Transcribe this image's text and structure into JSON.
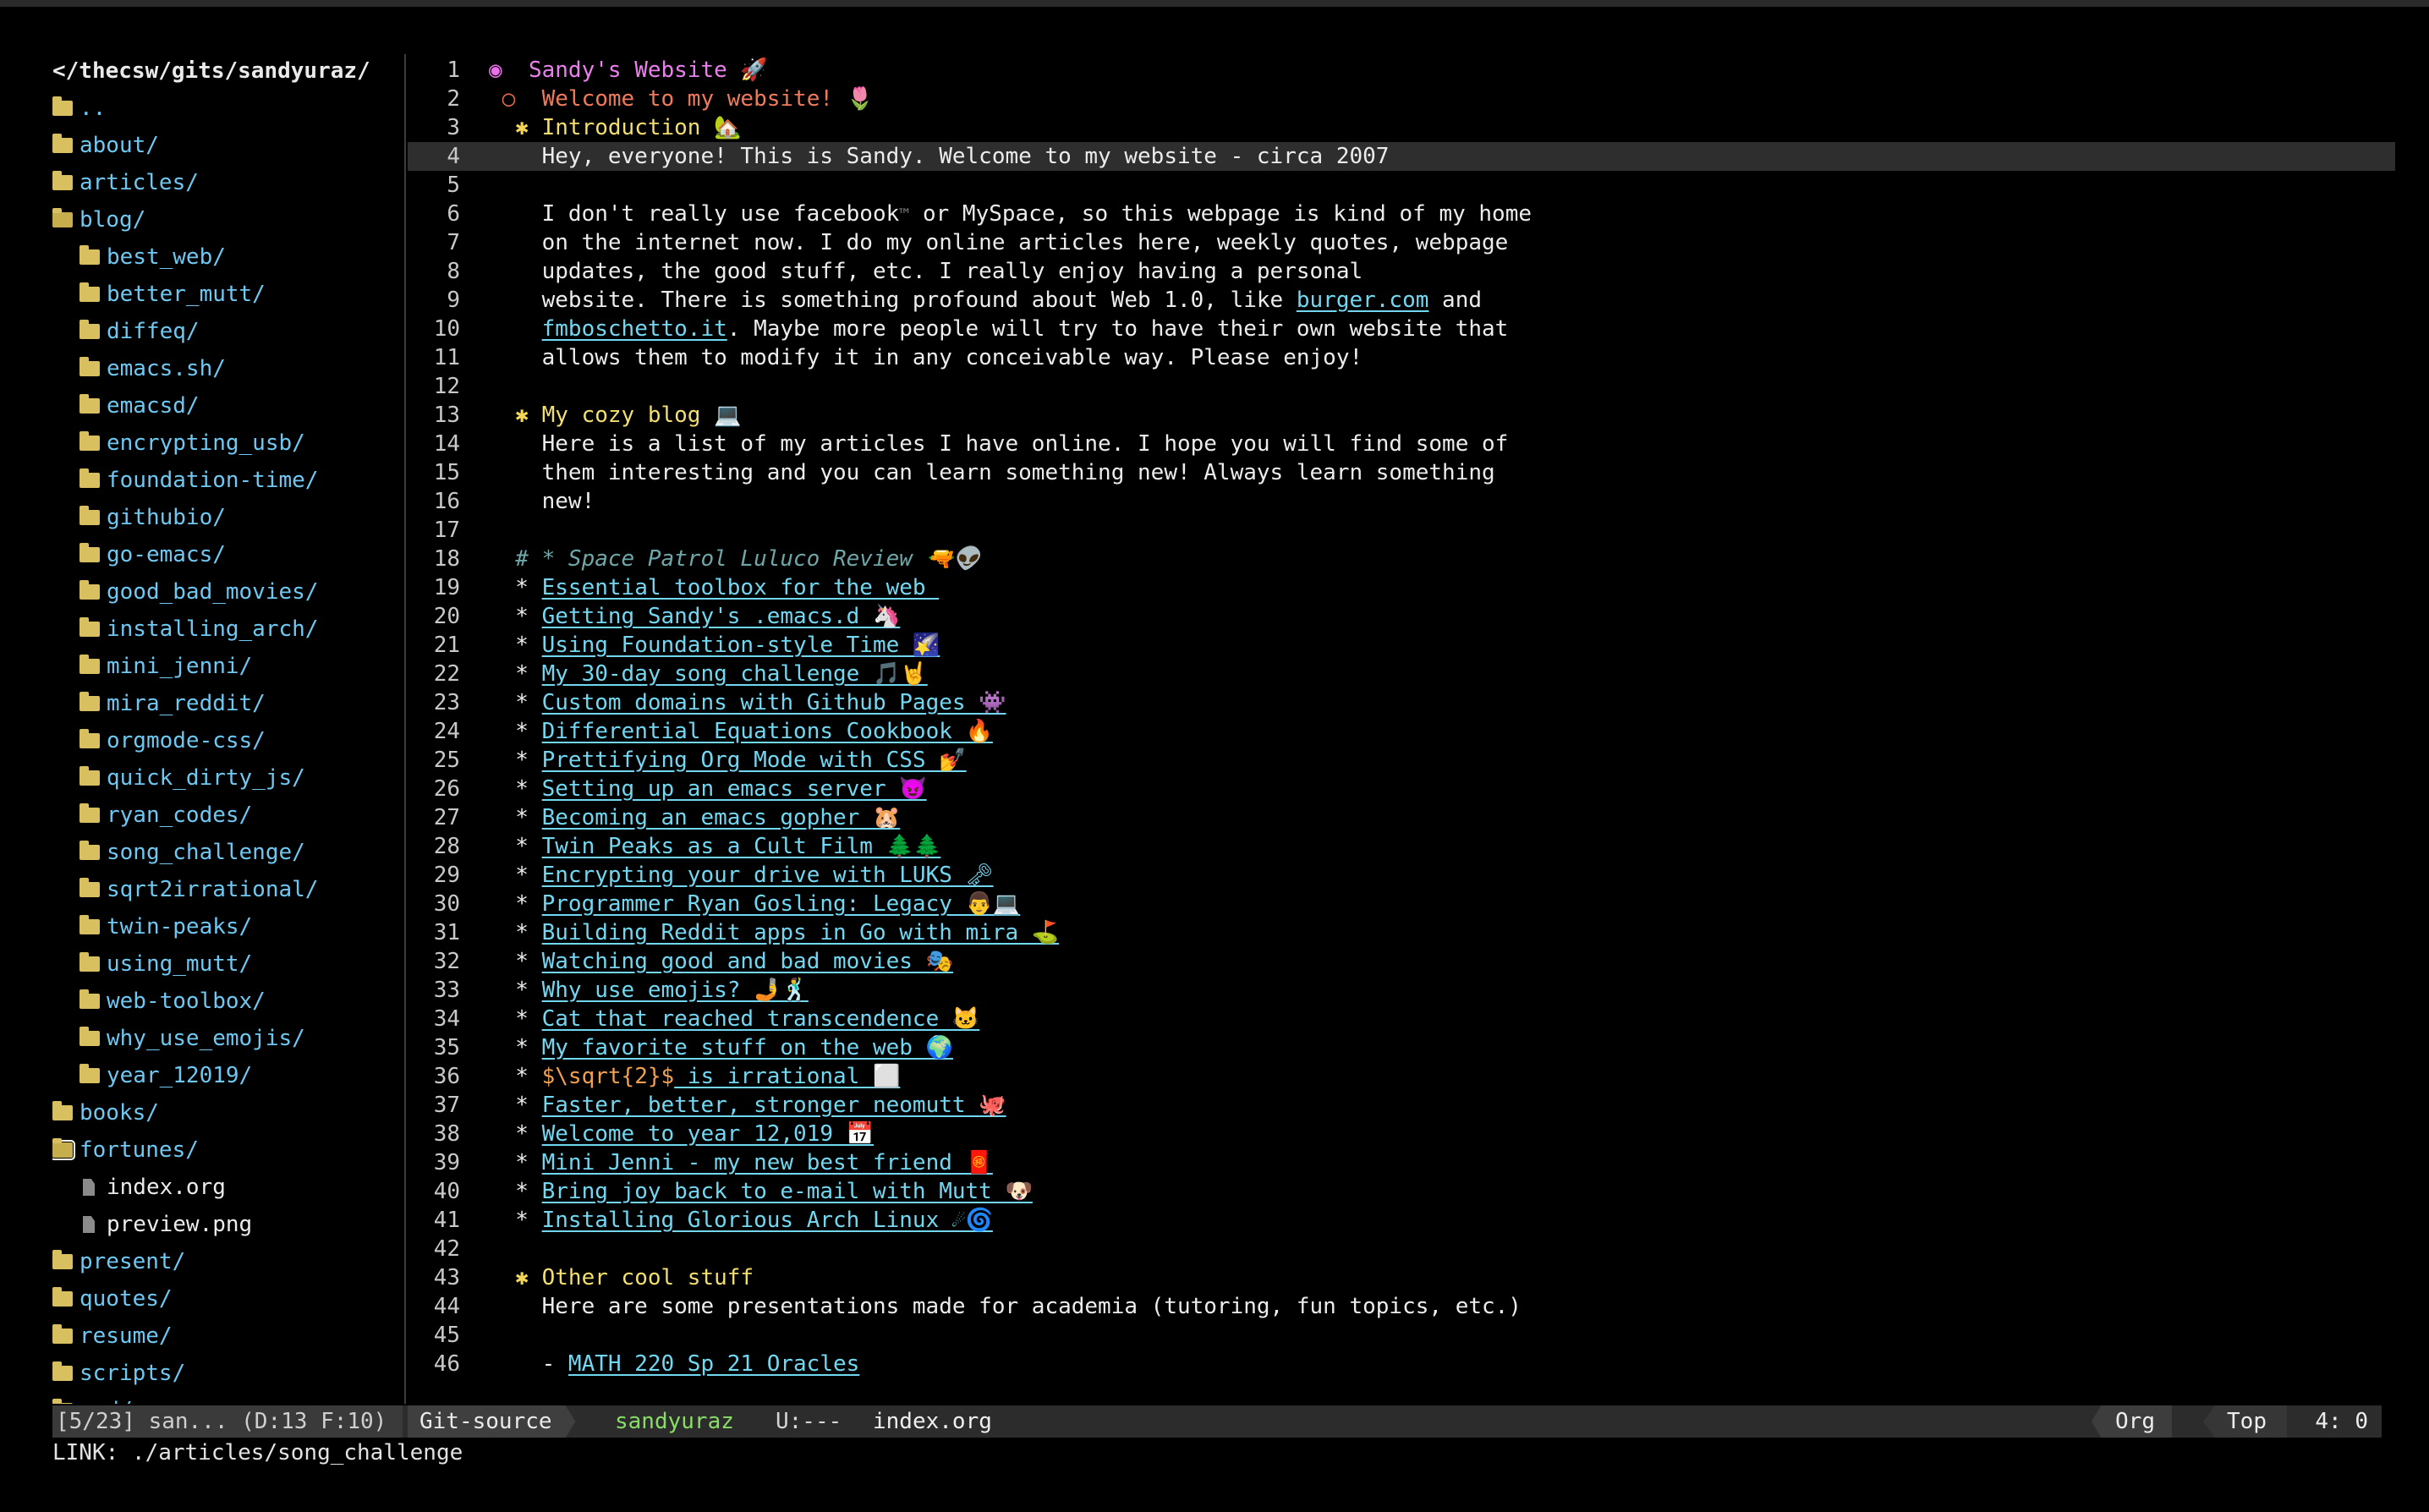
{
  "sidebar": {
    "header": "</thecsw/gits/sandyuraz/",
    "items": [
      {
        "name": "..",
        "type": "dir",
        "depth": 0
      },
      {
        "name": "about/",
        "type": "dir",
        "depth": 0
      },
      {
        "name": "articles/",
        "type": "dir",
        "depth": 0
      },
      {
        "name": "blog/",
        "type": "dir-open",
        "depth": 0
      },
      {
        "name": "best_web/",
        "type": "dir",
        "depth": 1
      },
      {
        "name": "better_mutt/",
        "type": "dir",
        "depth": 1
      },
      {
        "name": "diffeq/",
        "type": "dir",
        "depth": 1
      },
      {
        "name": "emacs.sh/",
        "type": "dir",
        "depth": 1
      },
      {
        "name": "emacsd/",
        "type": "dir",
        "depth": 1
      },
      {
        "name": "encrypting_usb/",
        "type": "dir",
        "depth": 1
      },
      {
        "name": "foundation-time/",
        "type": "dir",
        "depth": 1
      },
      {
        "name": "githubio/",
        "type": "dir",
        "depth": 1
      },
      {
        "name": "go-emacs/",
        "type": "dir",
        "depth": 1
      },
      {
        "name": "good_bad_movies/",
        "type": "dir",
        "depth": 1
      },
      {
        "name": "installing_arch/",
        "type": "dir",
        "depth": 1
      },
      {
        "name": "mini_jenni/",
        "type": "dir",
        "depth": 1
      },
      {
        "name": "mira_reddit/",
        "type": "dir",
        "depth": 1
      },
      {
        "name": "orgmode-css/",
        "type": "dir",
        "depth": 1
      },
      {
        "name": "quick_dirty_js/",
        "type": "dir",
        "depth": 1
      },
      {
        "name": "ryan_codes/",
        "type": "dir",
        "depth": 1
      },
      {
        "name": "song_challenge/",
        "type": "dir",
        "depth": 1
      },
      {
        "name": "sqrt2irrational/",
        "type": "dir",
        "depth": 1
      },
      {
        "name": "twin-peaks/",
        "type": "dir",
        "depth": 1
      },
      {
        "name": "using_mutt/",
        "type": "dir",
        "depth": 1
      },
      {
        "name": "web-toolbox/",
        "type": "dir",
        "depth": 1
      },
      {
        "name": "why_use_emojis/",
        "type": "dir",
        "depth": 1
      },
      {
        "name": "year_12019/",
        "type": "dir",
        "depth": 1
      },
      {
        "name": "books/",
        "type": "dir",
        "depth": 0
      },
      {
        "name": "fortunes/",
        "type": "dir-open",
        "depth": 0,
        "cursor": true
      },
      {
        "name": "index.org",
        "type": "file",
        "depth": 1
      },
      {
        "name": "preview.png",
        "type": "file",
        "depth": 1
      },
      {
        "name": "present/",
        "type": "dir",
        "depth": 0
      },
      {
        "name": "quotes/",
        "type": "dir",
        "depth": 0
      },
      {
        "name": "resume/",
        "type": "dir",
        "depth": 0
      },
      {
        "name": "scripts/",
        "type": "dir",
        "depth": 0
      },
      {
        "name": "sed/",
        "type": "dir",
        "depth": 0
      }
    ]
  },
  "editor": {
    "current_line": 4,
    "lines": [
      {
        "n": "1",
        "parts": [
          [
            "bullet",
            "◉  "
          ],
          [
            "h1",
            "Sandy's Website 🚀"
          ]
        ]
      },
      {
        "n": "2",
        "parts": [
          [
            "bullet2",
            " ○  "
          ],
          [
            "h2",
            "Welcome to my website! 🌷"
          ]
        ]
      },
      {
        "n": "3",
        "parts": [
          [
            "star3",
            "  ✱ "
          ],
          [
            "h3",
            "Introduction 🏡"
          ]
        ]
      },
      {
        "n": "4",
        "parts": [
          [
            "plain",
            "    Hey, everyone! This is Sandy. Welcome to my website - circa 2007"
          ]
        ]
      },
      {
        "n": "5",
        "parts": []
      },
      {
        "n": "6",
        "parts": [
          [
            "plain",
            "    I don't really use facebook"
          ],
          [
            "tm",
            "™"
          ],
          [
            "plain",
            " or MySpace, so this webpage is kind of my home"
          ]
        ]
      },
      {
        "n": "7",
        "parts": [
          [
            "plain",
            "    on the internet now. I do my online articles here, weekly quotes, webpage"
          ]
        ]
      },
      {
        "n": "8",
        "parts": [
          [
            "plain",
            "    updates, the good stuff, etc. I really enjoy having a personal"
          ]
        ]
      },
      {
        "n": "9",
        "parts": [
          [
            "plain",
            "    website. There is something profound about Web 1.0, like "
          ],
          [
            "link",
            "burger.com"
          ],
          [
            "plain",
            " and"
          ]
        ]
      },
      {
        "n": "10",
        "parts": [
          [
            "plain",
            "    "
          ],
          [
            "link",
            "fmboschetto.it"
          ],
          [
            "plain",
            ". Maybe more people will try to have their own website that"
          ]
        ]
      },
      {
        "n": "11",
        "parts": [
          [
            "plain",
            "    allows them to modify it in any conceivable way. Please enjoy!"
          ]
        ]
      },
      {
        "n": "12",
        "parts": []
      },
      {
        "n": "13",
        "parts": [
          [
            "star3",
            "  ✱ "
          ],
          [
            "h3",
            "My cozy blog 💻"
          ]
        ]
      },
      {
        "n": "14",
        "parts": [
          [
            "plain",
            "    Here is a list of my articles I have online. I hope you will find some of"
          ]
        ]
      },
      {
        "n": "15",
        "parts": [
          [
            "plain",
            "    them interesting and you can learn something new! Always learn something"
          ]
        ]
      },
      {
        "n": "16",
        "parts": [
          [
            "plain",
            "    new!"
          ]
        ]
      },
      {
        "n": "17",
        "parts": []
      },
      {
        "n": "18",
        "parts": [
          [
            "cmt",
            "  # * Space Patrol Luluco Review 🔫👽"
          ]
        ]
      },
      {
        "n": "19",
        "parts": [
          [
            "plain",
            "  * "
          ],
          [
            "link",
            "Essential toolbox for the web "
          ]
        ]
      },
      {
        "n": "20",
        "parts": [
          [
            "plain",
            "  * "
          ],
          [
            "link",
            "Getting Sandy's .emacs.d 🦄"
          ]
        ]
      },
      {
        "n": "21",
        "parts": [
          [
            "plain",
            "  * "
          ],
          [
            "link",
            "Using Foundation-style Time 🌠"
          ]
        ]
      },
      {
        "n": "22",
        "parts": [
          [
            "plain",
            "  * "
          ],
          [
            "link",
            "My 30-day song challenge 🎵🤘"
          ]
        ]
      },
      {
        "n": "23",
        "parts": [
          [
            "plain",
            "  * "
          ],
          [
            "link",
            "Custom domains with Github Pages 👾"
          ]
        ]
      },
      {
        "n": "24",
        "parts": [
          [
            "plain",
            "  * "
          ],
          [
            "link",
            "Differential Equations Cookbook 🔥"
          ]
        ]
      },
      {
        "n": "25",
        "parts": [
          [
            "plain",
            "  * "
          ],
          [
            "link",
            "Prettifying Org Mode with CSS 💅"
          ]
        ]
      },
      {
        "n": "26",
        "parts": [
          [
            "plain",
            "  * "
          ],
          [
            "link",
            "Setting up an emacs server 😈"
          ]
        ]
      },
      {
        "n": "27",
        "parts": [
          [
            "plain",
            "  * "
          ],
          [
            "link",
            "Becoming an emacs gopher 🐹"
          ]
        ]
      },
      {
        "n": "28",
        "parts": [
          [
            "plain",
            "  * "
          ],
          [
            "link",
            "Twin Peaks as a Cult Film 🌲🌲"
          ]
        ]
      },
      {
        "n": "29",
        "parts": [
          [
            "plain",
            "  * "
          ],
          [
            "link",
            "Encrypting your drive with LUKS 🗝"
          ]
        ]
      },
      {
        "n": "30",
        "parts": [
          [
            "plain",
            "  * "
          ],
          [
            "link",
            "Programmer Ryan Gosling: Legacy 👨💻"
          ]
        ]
      },
      {
        "n": "31",
        "parts": [
          [
            "plain",
            "  * "
          ],
          [
            "link",
            "Building Reddit apps in Go with mira ⛳"
          ]
        ]
      },
      {
        "n": "32",
        "parts": [
          [
            "plain",
            "  * "
          ],
          [
            "link",
            "Watching good and bad movies 🎭"
          ]
        ]
      },
      {
        "n": "33",
        "parts": [
          [
            "plain",
            "  * "
          ],
          [
            "link",
            "Why use emojis? 🤳🕺"
          ]
        ]
      },
      {
        "n": "34",
        "parts": [
          [
            "plain",
            "  * "
          ],
          [
            "link",
            "Cat that reached transcendence 🐱"
          ]
        ]
      },
      {
        "n": "35",
        "parts": [
          [
            "plain",
            "  * "
          ],
          [
            "link",
            "My favorite stuff on the web 🌍"
          ]
        ]
      },
      {
        "n": "36",
        "parts": [
          [
            "plain",
            "  * "
          ],
          [
            "latex",
            "$\\sqrt{2}$"
          ],
          [
            "link",
            " is irrational ⬜"
          ]
        ]
      },
      {
        "n": "37",
        "parts": [
          [
            "plain",
            "  * "
          ],
          [
            "link",
            "Faster, better, stronger neomutt 🐙"
          ]
        ]
      },
      {
        "n": "38",
        "parts": [
          [
            "plain",
            "  * "
          ],
          [
            "link",
            "Welcome to year 12,019 📅"
          ]
        ]
      },
      {
        "n": "39",
        "parts": [
          [
            "plain",
            "  * "
          ],
          [
            "link",
            "Mini Jenni - my new best friend 🧧"
          ]
        ]
      },
      {
        "n": "40",
        "parts": [
          [
            "plain",
            "  * "
          ],
          [
            "link",
            "Bring joy back to e-mail with Mutt 🐶"
          ]
        ]
      },
      {
        "n": "41",
        "parts": [
          [
            "plain",
            "  * "
          ],
          [
            "link",
            "Installing Glorious Arch Linux ☄🌀"
          ]
        ]
      },
      {
        "n": "42",
        "parts": []
      },
      {
        "n": "43",
        "parts": [
          [
            "star3",
            "  ✱ "
          ],
          [
            "h3",
            "Other cool stuff"
          ]
        ]
      },
      {
        "n": "44",
        "parts": [
          [
            "plain",
            "    Here are some presentations made for academia (tutoring, fun topics, etc.)"
          ]
        ]
      },
      {
        "n": "45",
        "parts": []
      },
      {
        "n": "46",
        "parts": [
          [
            "plain",
            "    - "
          ],
          [
            "link",
            "MATH 220 Sp 21 Oracles"
          ]
        ]
      }
    ]
  },
  "modeline": {
    "left": "[5/23] san... (D:13 F:10)",
    "vc": "Git-source",
    "branch": "sandyuraz",
    "state": "U:---",
    "file": "index.org",
    "mode": "Org",
    "position": "Top",
    "cursor": "4: 0"
  },
  "echo_area": "LINK: ./articles/song_challenge"
}
